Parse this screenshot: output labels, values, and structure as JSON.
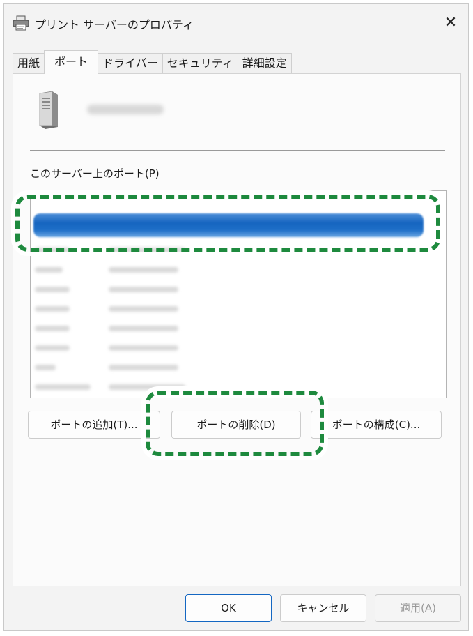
{
  "window": {
    "title": "プリント サーバーのプロパティ"
  },
  "tabs": [
    {
      "label": "用紙",
      "active": false
    },
    {
      "label": "ポート",
      "active": true
    },
    {
      "label": "ドライバー",
      "active": false
    },
    {
      "label": "セキュリティ",
      "active": false
    },
    {
      "label": "詳細設定",
      "active": false
    }
  ],
  "panel": {
    "server_icon": "server-tower-icon",
    "ports_label": "このサーバー上のポート(P)",
    "port_rows_count_visible": 9,
    "selected_row_index": 0
  },
  "buttons": {
    "add_port": "ポートの追加(T)...",
    "delete_port": "ポートの削除(D)",
    "configure_port": "ポートの構成(C)...",
    "ok": "OK",
    "cancel": "キャンセル",
    "apply": "適用(A)"
  },
  "colors": {
    "highlight": "#1e8a3e",
    "selection": "#1665c0",
    "primary_border": "#1467c2"
  }
}
